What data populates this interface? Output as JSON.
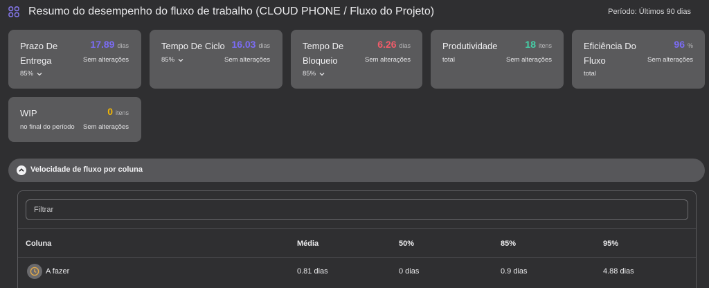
{
  "header": {
    "title": "Resumo do desempenho do fluxo de trabalho (CLOUD PHONE / Fluxo do Projeto)",
    "period": "Período: Últimos 90 dias"
  },
  "colors": {
    "background": "#2f2f31",
    "card": "#5a5a5c",
    "accent_purple": "#7b6cf6",
    "accent_red": "#f25c6a",
    "accent_green": "#45d0a8",
    "accent_yellow": "#f2b705"
  },
  "metrics": [
    {
      "label_line1": "Prazo De",
      "label_line2": "Entrega",
      "value": "17.89",
      "unit": "dias",
      "change": "Sem alterações",
      "sub": "85%"
    },
    {
      "label_line1": "Tempo De Ciclo",
      "label_line2": "",
      "value": "16.03",
      "unit": "dias",
      "change": "Sem alterações",
      "sub": "85%"
    },
    {
      "label_line1": "Tempo De",
      "label_line2": "Bloqueio",
      "value": "6.26",
      "unit": "dias",
      "change": "Sem alterações",
      "sub": "85%"
    },
    {
      "label_line1": "Produtividade",
      "label_line2": "",
      "value": "18",
      "unit": "itens",
      "change": "Sem alterações",
      "sub": "total"
    },
    {
      "label_line1": "Eficiência Do",
      "label_line2": "Fluxo",
      "value": "96",
      "unit": "%",
      "change": "Sem alterações",
      "sub": "total"
    },
    {
      "label_line1": "WIP",
      "label_line2": "",
      "value": "0",
      "unit": "itens",
      "change": "Sem alterações",
      "sub": "no final do período"
    }
  ],
  "section": {
    "title": "Velocidade de fluxo por coluna",
    "filter_placeholder": "Filtrar",
    "columns": [
      "Coluna",
      "Média",
      "50%",
      "85%",
      "95%"
    ],
    "rows": [
      {
        "name": "A fazer",
        "mean": "0.81 dias",
        "p50": "0 dias",
        "p85": "0.9 dias",
        "p95": "4.88 dias",
        "icon": "clock-icon"
      }
    ]
  }
}
